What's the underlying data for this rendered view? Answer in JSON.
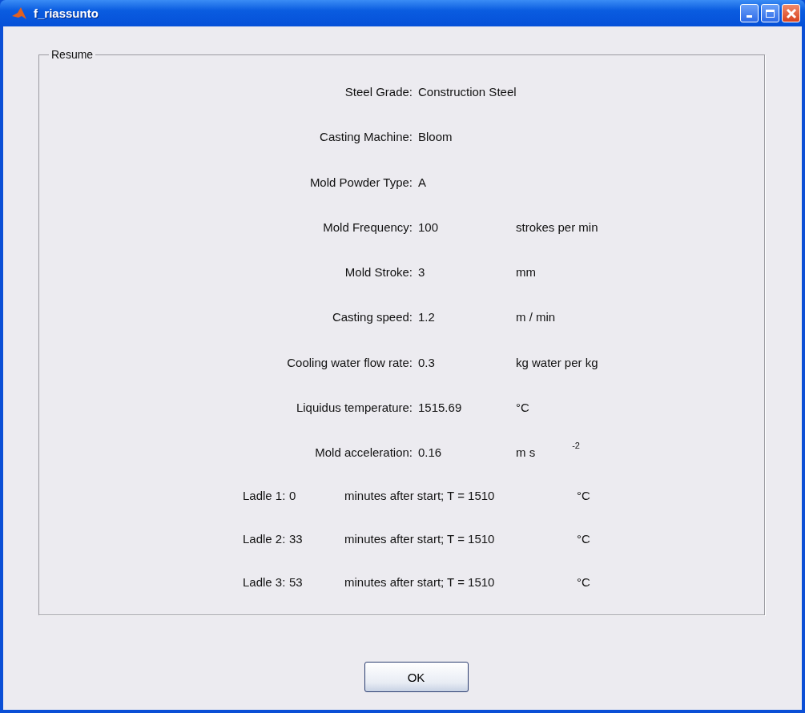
{
  "window": {
    "title": "f_riassunto"
  },
  "panel": {
    "title": "Resume",
    "fields": [
      {
        "label": "Steel Grade:",
        "value": "Construction Steel"
      },
      {
        "label": "Casting Machine:",
        "value": "Bloom"
      },
      {
        "label": "Mold Powder Type:",
        "value": "A"
      },
      {
        "label": "Mold Frequency:",
        "value": "100",
        "unit": "strokes per min"
      },
      {
        "label": "Mold Stroke:",
        "value": "3",
        "unit": "mm"
      },
      {
        "label": "Casting speed:",
        "value": "1.2",
        "unit": "m / min"
      },
      {
        "label": "Cooling water flow rate:",
        "value": "0.3",
        "unit": "kg water per kg"
      },
      {
        "label": "Liquidus temperature:",
        "value": "1515.69",
        "unit": "°C"
      },
      {
        "label": "Mold acceleration:",
        "value": "0.16",
        "unit": "m s",
        "exponent": "-2"
      }
    ],
    "ladles": [
      {
        "label": "Ladle 1:",
        "value": "0",
        "text": "minutes after start; T = 1510",
        "unit": "°C"
      },
      {
        "label": "Ladle 2:",
        "value": "33",
        "text": "minutes after start; T = 1510",
        "unit": "°C"
      },
      {
        "label": "Ladle 3:",
        "value": "53",
        "text": "minutes after start; T = 1510",
        "unit": "°C"
      }
    ]
  },
  "buttons": [
    "OK"
  ]
}
